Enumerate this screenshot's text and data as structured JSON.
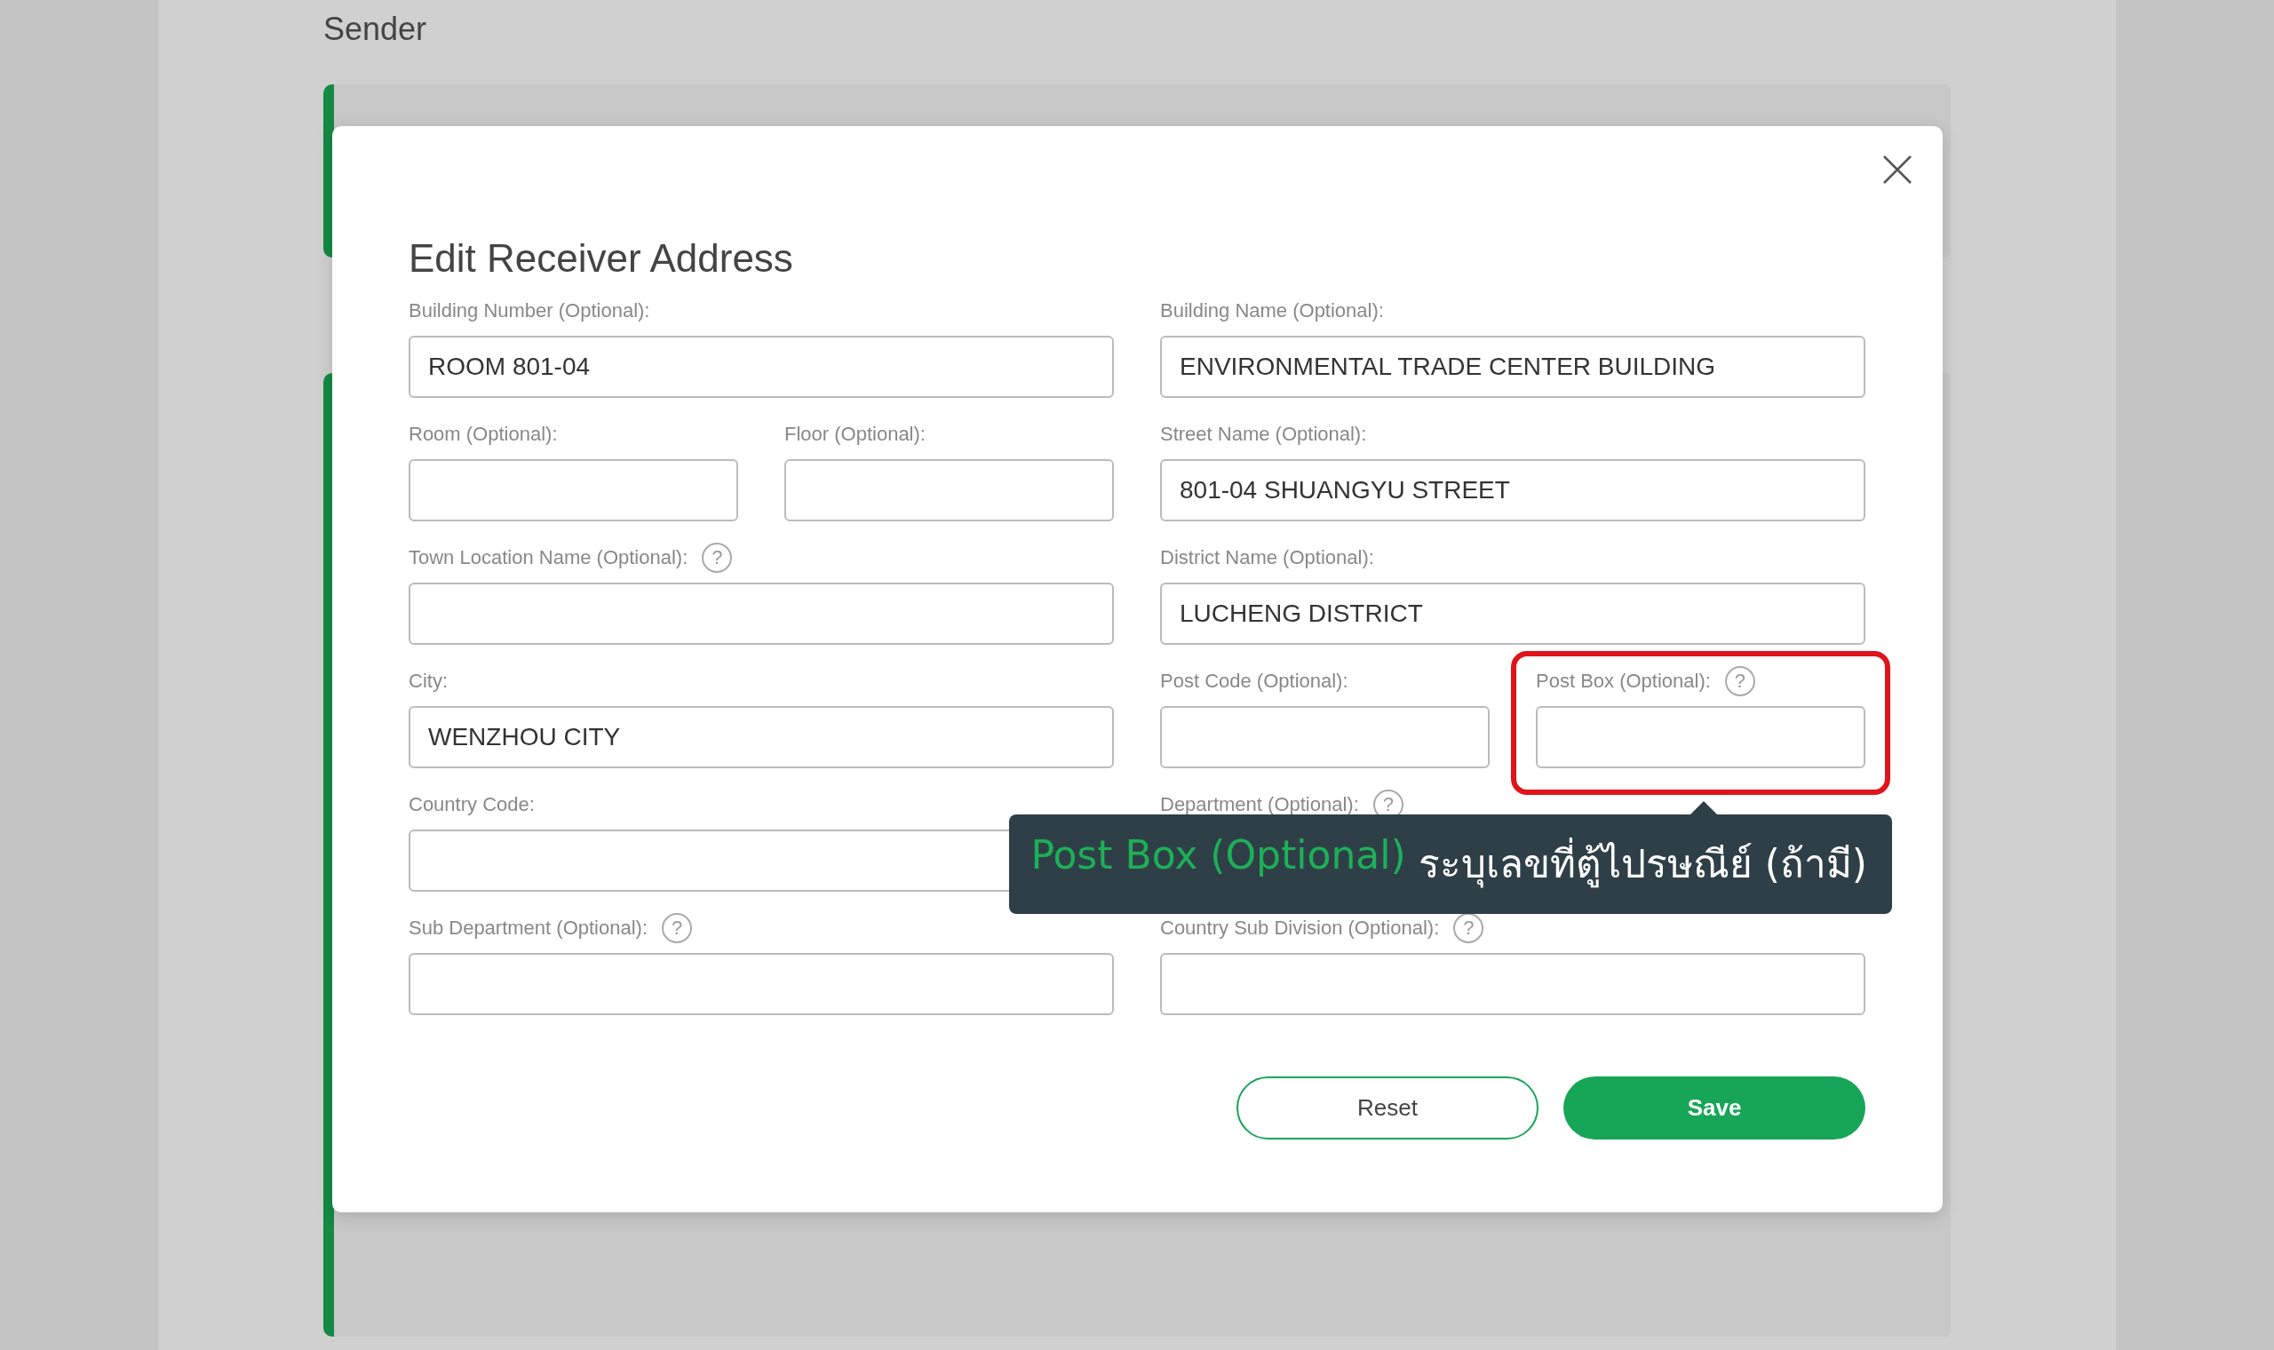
{
  "page": {
    "heading": "Sender"
  },
  "modal": {
    "title": "Edit Receiver Address",
    "rows": [
      {
        "columns": [
          [
            {
              "label": "Building Number (Optional):",
              "value": "ROOM 801-04"
            }
          ],
          [
            {
              "label": "Building Name (Optional):",
              "value": "ENVIRONMENTAL TRADE CENTER BUILDING"
            }
          ]
        ]
      },
      {
        "columns": [
          [
            {
              "label": "Room (Optional):"
            },
            {
              "label": "Floor (Optional):"
            }
          ],
          [
            {
              "label": "Street Name (Optional):",
              "value": "801-04 SHUANGYU STREET"
            }
          ]
        ]
      },
      {
        "columns": [
          [
            {
              "label": "Town Location Name (Optional):",
              "help": "?"
            }
          ],
          [
            {
              "label": "District Name (Optional):",
              "value": "LUCHENG DISTRICT"
            }
          ]
        ]
      },
      {
        "columns": [
          [
            {
              "label": "City:",
              "value": "WENZHOU CITY"
            }
          ],
          [
            {
              "label": "Post Code (Optional):"
            },
            {
              "label": "Post Box (Optional):",
              "help": "?",
              "highlighted": true
            }
          ]
        ]
      },
      {
        "columns": [
          [
            {
              "label": "Country Code:"
            }
          ],
          [
            {
              "label": "Department (Optional):",
              "help": "?"
            }
          ]
        ]
      },
      {
        "columns": [
          [
            {
              "label": "Sub Department (Optional):",
              "help": "?"
            }
          ],
          [
            {
              "label": "Country Sub Division (Optional):",
              "help": "?"
            }
          ]
        ]
      }
    ],
    "tooltip": {
      "title": "Post Box (Optional)",
      "text": "ระบุเลขที่ตู้ไปรษณีย์ (ถ้ามี)"
    },
    "buttons": [
      {
        "label": "Reset",
        "kind": "secondary"
      },
      {
        "label": "Save",
        "kind": "primary"
      }
    ]
  }
}
